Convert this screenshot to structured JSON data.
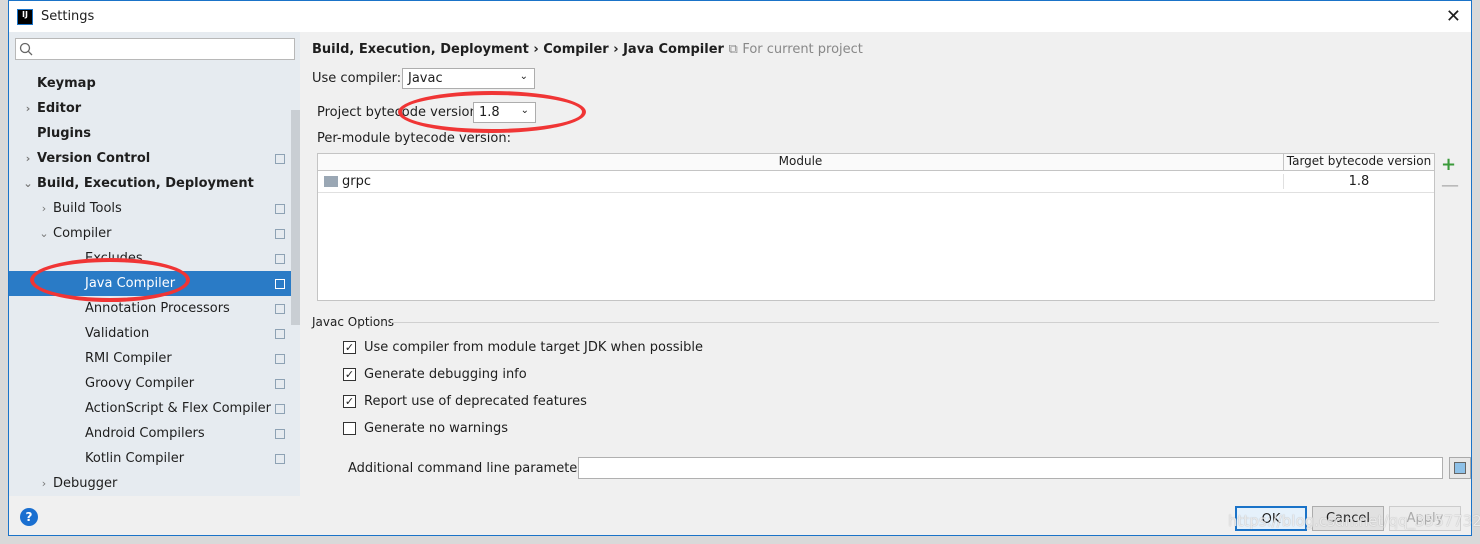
{
  "window": {
    "title": "Settings",
    "logo": "IJ"
  },
  "sidebar": {
    "search_placeholder": "",
    "items": [
      {
        "label": "Keymap",
        "level": 0,
        "bold": true,
        "arrow": ""
      },
      {
        "label": "Editor",
        "level": 0,
        "bold": true,
        "arrow": "›"
      },
      {
        "label": "Plugins",
        "level": 0,
        "bold": true,
        "arrow": ""
      },
      {
        "label": "Version Control",
        "level": 0,
        "bold": true,
        "arrow": "›",
        "copy": true
      },
      {
        "label": "Build, Execution, Deployment",
        "level": 0,
        "bold": true,
        "arrow": "⌄"
      },
      {
        "label": "Build Tools",
        "level": 1,
        "arrow": "›",
        "copy": true
      },
      {
        "label": "Compiler",
        "level": 1,
        "arrow": "⌄",
        "copy": true
      },
      {
        "label": "Excludes",
        "level": 2,
        "copy": true
      },
      {
        "label": "Java Compiler",
        "level": 2,
        "copy": true,
        "selected": true
      },
      {
        "label": "Annotation Processors",
        "level": 2,
        "copy": true
      },
      {
        "label": "Validation",
        "level": 2,
        "copy": true
      },
      {
        "label": "RMI Compiler",
        "level": 2,
        "copy": true
      },
      {
        "label": "Groovy Compiler",
        "level": 2,
        "copy": true
      },
      {
        "label": "ActionScript & Flex Compiler",
        "level": 2,
        "copy": true
      },
      {
        "label": "Android Compilers",
        "level": 2,
        "copy": true
      },
      {
        "label": "Kotlin Compiler",
        "level": 2,
        "copy": true
      },
      {
        "label": "Debugger",
        "level": 1,
        "arrow": "›"
      }
    ]
  },
  "breadcrumb": {
    "path": "Build, Execution, Deployment › Compiler › Java Compiler",
    "scope": "For current project"
  },
  "use_compiler": {
    "label": "Use compiler:",
    "value": "Javac"
  },
  "bytecode": {
    "label": "Project bytecode version:",
    "value": "1.8"
  },
  "per_module": {
    "label": "Per-module bytecode version:",
    "columns": [
      "Module",
      "Target bytecode version"
    ],
    "rows": [
      {
        "module": "grpc",
        "version": "1.8"
      }
    ]
  },
  "javac": {
    "section": "Javac Options",
    "options": [
      {
        "label": "Use compiler from module target JDK when possible",
        "checked": true
      },
      {
        "label": "Generate debugging info",
        "checked": true
      },
      {
        "label": "Report use of deprecated features",
        "checked": true
      },
      {
        "label": "Generate no warnings",
        "checked": false
      }
    ],
    "params_label": "Additional command line parameters:",
    "params_value": ""
  },
  "buttons": {
    "ok": "OK",
    "cancel": "Cancel",
    "apply": "Apply",
    "help": "?"
  },
  "watermark": "https://blog.csdn.net/qq_35577329",
  "colors": {
    "selection": "#2a7bc6",
    "annotation": "#f03535"
  }
}
